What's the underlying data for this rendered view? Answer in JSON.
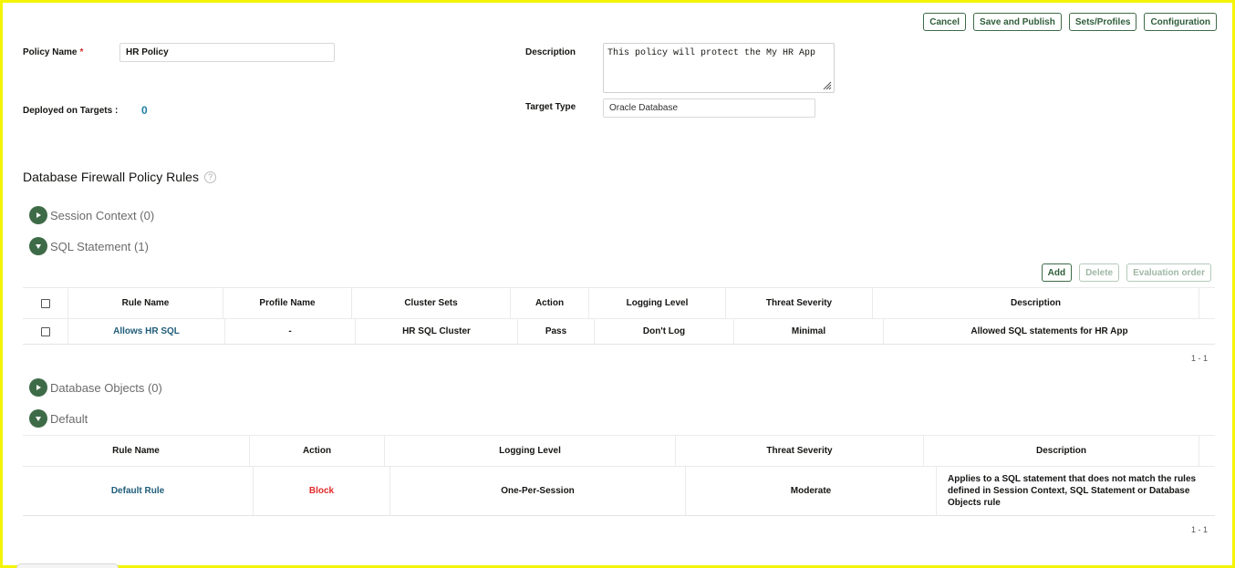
{
  "toolbar": {
    "cancel": "Cancel",
    "save_publish": "Save and Publish",
    "sets_profiles": "Sets/Profiles",
    "configuration": "Configuration"
  },
  "form": {
    "policy_name_label": "Policy Name",
    "required_marker": "*",
    "policy_name_value": "HR Policy",
    "deployed_label": "Deployed on Targets :",
    "deployed_count": "0",
    "description_label": "Description",
    "description_value": "This policy will protect the My HR App",
    "target_type_label": "Target Type",
    "target_type_value": "Oracle Database"
  },
  "rules": {
    "title": "Database Firewall Policy Rules",
    "help_icon": "question-circle-icon",
    "groups": {
      "session_context": "Session Context (0)",
      "sql_statement": "SQL Statement (1)",
      "database_objects": "Database Objects (0)",
      "default": "Default"
    }
  },
  "sql_table": {
    "actions": {
      "add": "Add",
      "delete": "Delete",
      "evaluation_order": "Evaluation order"
    },
    "headers": [
      "Rule Name",
      "Profile Name",
      "Cluster Sets",
      "Action",
      "Logging Level",
      "Threat Severity",
      "Description"
    ],
    "rows": [
      [
        "Allows HR SQL",
        "-",
        "HR SQL Cluster",
        "Pass",
        "Don't Log",
        "Minimal",
        "Allowed SQL statements for HR App"
      ]
    ],
    "pager": "1 - 1"
  },
  "default_table": {
    "headers": [
      "Rule Name",
      "Action",
      "Logging Level",
      "Threat Severity",
      "Description"
    ],
    "rows": [
      [
        "Default Rule",
        "Block",
        "One-Per-Session",
        "Moderate",
        "Applies to a SQL statement that does not match the rules defined in Session Context, SQL Statement or Database Objects rule"
      ]
    ],
    "pager": "1 - 1"
  },
  "colors": {
    "accent_green": "#3e6b47",
    "link_blue": "#1f5d7a",
    "block_red": "#e02a2a",
    "frame_yellow": "#f4f400"
  }
}
